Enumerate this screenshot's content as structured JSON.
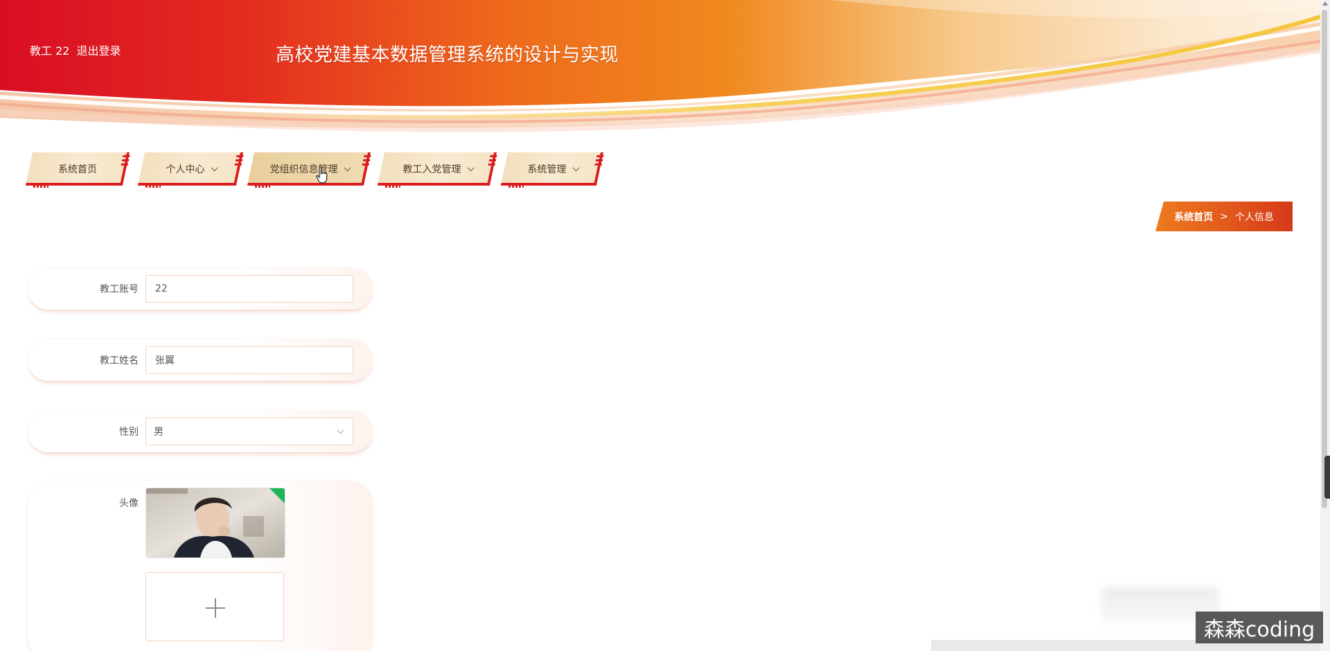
{
  "header": {
    "user_label": "教工 22",
    "logout_label": "退出登录",
    "site_title": "高校党建基本数据管理系统的设计与实现"
  },
  "nav": {
    "items": [
      {
        "label": "系统首页"
      },
      {
        "label": "个人中心"
      },
      {
        "label": "党组织信息管理"
      },
      {
        "label": "教工入党管理"
      },
      {
        "label": "系统管理"
      }
    ]
  },
  "breadcrumb": {
    "home": "系统首页",
    "separator": ">",
    "current": "个人信息"
  },
  "form": {
    "account_label": "教工账号",
    "account_value": "22",
    "name_label": "教工姓名",
    "name_value": "张翼",
    "gender_label": "性别",
    "gender_value": "男",
    "avatar_label": "头像"
  },
  "watermark": "森森coding",
  "colors": {
    "primary_red": "#d81e1e",
    "banner_orange": "#ee7a20",
    "nav_bg": "#f3dfbd"
  }
}
